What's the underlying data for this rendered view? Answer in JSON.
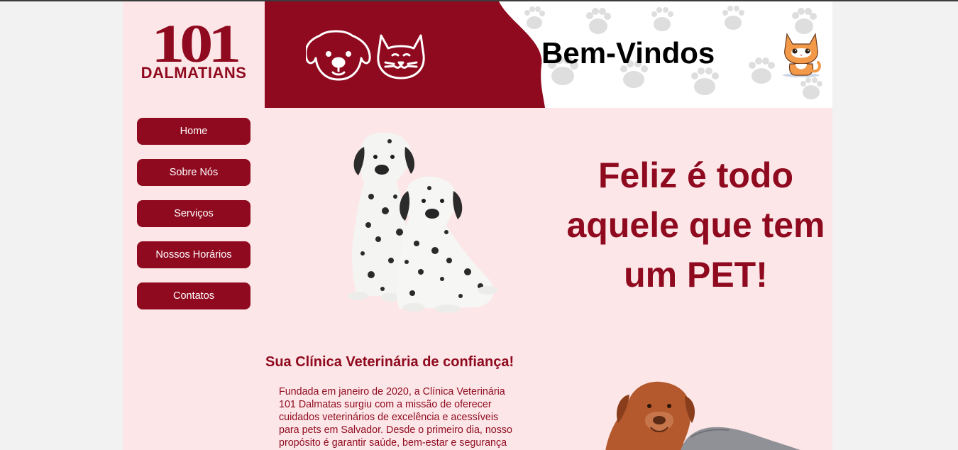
{
  "logo": {
    "number": "101",
    "word": "DALMATIANS"
  },
  "header": {
    "welcome": "Bem-Vindos"
  },
  "nav": {
    "items": [
      {
        "label": "Home"
      },
      {
        "label": "Sobre Nós"
      },
      {
        "label": "Serviços"
      },
      {
        "label": "Nossos Horários"
      },
      {
        "label": "Contatos"
      }
    ]
  },
  "hero": {
    "slogan": "Feliz é todo aquele que tem um PET!"
  },
  "about": {
    "title": "Sua Clínica Veterinária de confiança!",
    "text": "Fundada em janeiro de 2020, a Clínica Veterinária 101 Dalmatas surgiu com a missão de oferecer cuidados veterinários de excelência e acessíveis para pets em Salvador. Desde o primeiro dia, nosso propósito é garantir saúde, bem-estar e segurança"
  },
  "colors": {
    "brand": "#8f0a1f",
    "background": "#fce6e7",
    "button_text": "#ffffff"
  },
  "icons": [
    "dog-outline-icon",
    "cat-outline-icon",
    "cat-mascot-icon",
    "paw-print-icon"
  ]
}
